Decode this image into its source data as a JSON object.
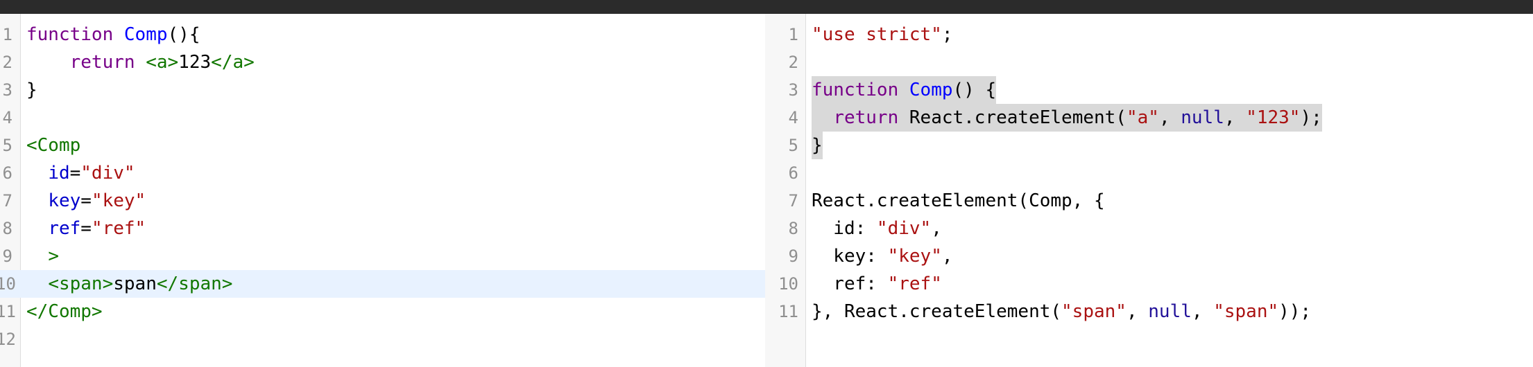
{
  "left": {
    "active_line": 10,
    "lines": [
      {
        "n": "1",
        "tokens": [
          {
            "t": "function",
            "c": "kw"
          },
          {
            "t": " ",
            "c": "txt"
          },
          {
            "t": "Comp",
            "c": "def"
          },
          {
            "t": "(){",
            "c": "txt"
          }
        ]
      },
      {
        "n": "2",
        "tokens": [
          {
            "t": "    ",
            "c": "txt"
          },
          {
            "t": "return",
            "c": "kw"
          },
          {
            "t": " ",
            "c": "txt"
          },
          {
            "t": "<a>",
            "c": "tag"
          },
          {
            "t": "123",
            "c": "txt"
          },
          {
            "t": "</a>",
            "c": "tag"
          }
        ]
      },
      {
        "n": "3",
        "tokens": [
          {
            "t": "}",
            "c": "txt"
          }
        ]
      },
      {
        "n": "4",
        "tokens": []
      },
      {
        "n": "5",
        "tokens": [
          {
            "t": "<Comp",
            "c": "tag"
          }
        ]
      },
      {
        "n": "6",
        "tokens": [
          {
            "t": "  ",
            "c": "txt"
          },
          {
            "t": "id",
            "c": "attr"
          },
          {
            "t": "=",
            "c": "txt"
          },
          {
            "t": "\"div\"",
            "c": "str"
          }
        ]
      },
      {
        "n": "7",
        "tokens": [
          {
            "t": "  ",
            "c": "txt"
          },
          {
            "t": "key",
            "c": "attr"
          },
          {
            "t": "=",
            "c": "txt"
          },
          {
            "t": "\"key\"",
            "c": "str"
          }
        ]
      },
      {
        "n": "8",
        "tokens": [
          {
            "t": "  ",
            "c": "txt"
          },
          {
            "t": "ref",
            "c": "attr"
          },
          {
            "t": "=",
            "c": "txt"
          },
          {
            "t": "\"ref\"",
            "c": "str"
          }
        ]
      },
      {
        "n": "9",
        "tokens": [
          {
            "t": "  ",
            "c": "txt"
          },
          {
            "t": ">",
            "c": "tag"
          }
        ]
      },
      {
        "n": "10",
        "tokens": [
          {
            "t": "  ",
            "c": "txt"
          },
          {
            "t": "<span>",
            "c": "tag"
          },
          {
            "t": "span",
            "c": "txt"
          },
          {
            "t": "</span>",
            "c": "tag"
          }
        ]
      },
      {
        "n": "11",
        "tokens": [
          {
            "t": "</Comp>",
            "c": "tag"
          }
        ]
      },
      {
        "n": "12",
        "tokens": []
      }
    ]
  },
  "right": {
    "selected_lines": [
      3,
      4,
      5
    ],
    "lines": [
      {
        "n": "1",
        "tokens": [
          {
            "t": "\"use strict\"",
            "c": "str"
          },
          {
            "t": ";",
            "c": "txt"
          }
        ]
      },
      {
        "n": "2",
        "tokens": []
      },
      {
        "n": "3",
        "tokens": [
          {
            "t": "function",
            "c": "kw"
          },
          {
            "t": " ",
            "c": "txt"
          },
          {
            "t": "Comp",
            "c": "def"
          },
          {
            "t": "() {",
            "c": "txt"
          }
        ]
      },
      {
        "n": "4",
        "tokens": [
          {
            "t": "  ",
            "c": "txt"
          },
          {
            "t": "return",
            "c": "kw"
          },
          {
            "t": " React.createElement(",
            "c": "txt"
          },
          {
            "t": "\"a\"",
            "c": "str"
          },
          {
            "t": ", ",
            "c": "txt"
          },
          {
            "t": "null",
            "c": "atom"
          },
          {
            "t": ", ",
            "c": "txt"
          },
          {
            "t": "\"123\"",
            "c": "str"
          },
          {
            "t": ");",
            "c": "txt"
          }
        ]
      },
      {
        "n": "5",
        "tokens": [
          {
            "t": "}",
            "c": "txt"
          }
        ]
      },
      {
        "n": "6",
        "tokens": []
      },
      {
        "n": "7",
        "tokens": [
          {
            "t": "React.createElement(Comp, {",
            "c": "txt"
          }
        ]
      },
      {
        "n": "8",
        "tokens": [
          {
            "t": "  id: ",
            "c": "txt"
          },
          {
            "t": "\"div\"",
            "c": "str"
          },
          {
            "t": ",",
            "c": "txt"
          }
        ]
      },
      {
        "n": "9",
        "tokens": [
          {
            "t": "  key: ",
            "c": "txt"
          },
          {
            "t": "\"key\"",
            "c": "str"
          },
          {
            "t": ",",
            "c": "txt"
          }
        ]
      },
      {
        "n": "10",
        "tokens": [
          {
            "t": "  ref: ",
            "c": "txt"
          },
          {
            "t": "\"ref\"",
            "c": "str"
          }
        ]
      },
      {
        "n": "11",
        "tokens": [
          {
            "t": "}, React.createElement(",
            "c": "txt"
          },
          {
            "t": "\"span\"",
            "c": "str"
          },
          {
            "t": ", ",
            "c": "txt"
          },
          {
            "t": "null",
            "c": "atom"
          },
          {
            "t": ", ",
            "c": "txt"
          },
          {
            "t": "\"span\"",
            "c": "str"
          },
          {
            "t": "));",
            "c": "txt"
          }
        ]
      }
    ]
  }
}
